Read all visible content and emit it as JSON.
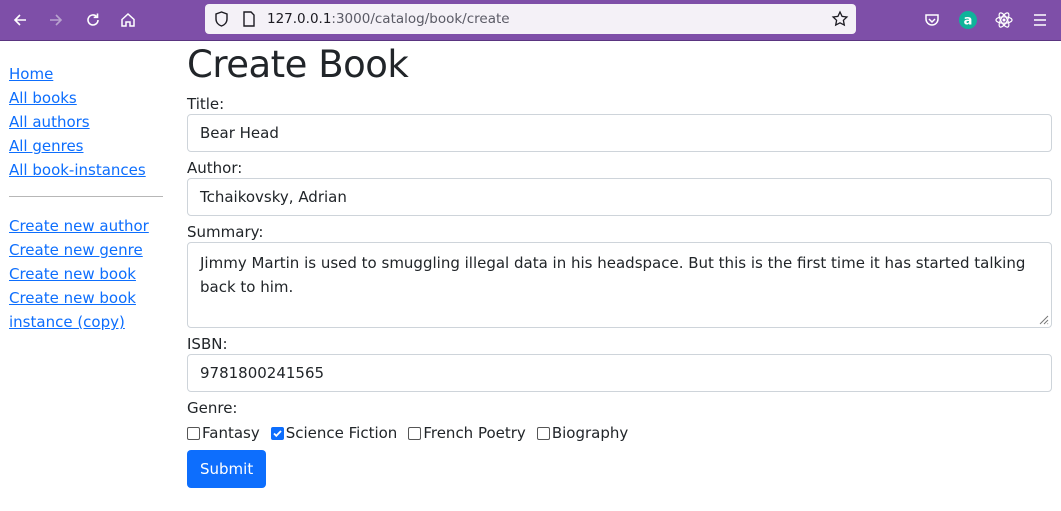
{
  "browser": {
    "url_host": "127.0.0.1",
    "url_rest": ":3000/catalog/book/create"
  },
  "sidebar": {
    "links": [
      "Home",
      "All books",
      "All authors",
      "All genres",
      "All book-instances"
    ],
    "create_links": [
      "Create new author",
      "Create new genre",
      "Create new book",
      "Create new book instance (copy)"
    ]
  },
  "form": {
    "heading": "Create Book",
    "title_label": "Title:",
    "title_value": "Bear Head",
    "author_label": "Author:",
    "author_value": "Tchaikovsky, Adrian",
    "summary_label": "Summary:",
    "summary_value": "Jimmy Martin is used to smuggling illegal data in his headspace.  But this is the first time it has started talking back to him.",
    "isbn_label": "ISBN:",
    "isbn_value": "9781800241565",
    "genre_label": "Genre:",
    "genres": [
      {
        "label": "Fantasy",
        "checked": false
      },
      {
        "label": "Science Fiction",
        "checked": true
      },
      {
        "label": "French Poetry",
        "checked": false
      },
      {
        "label": "Biography",
        "checked": false
      }
    ],
    "submit_label": "Submit"
  },
  "colors": {
    "toolbar": "#7e4fa8",
    "link": "#0d6efd",
    "button": "#0d6efd"
  }
}
